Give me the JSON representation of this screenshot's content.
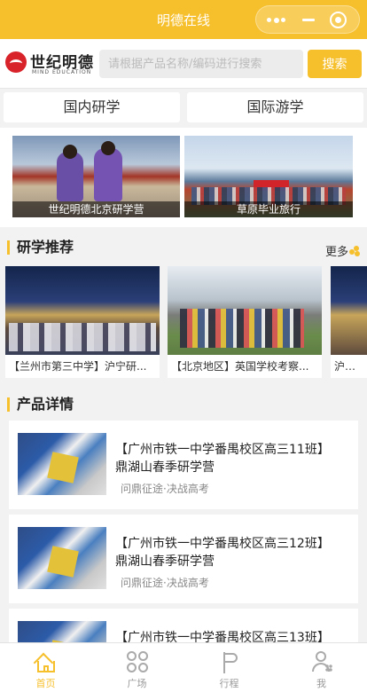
{
  "header": {
    "title": "明德在线"
  },
  "brand": {
    "name": "世纪明德",
    "sub": "MIND EDUCATION"
  },
  "search": {
    "placeholder": "请根据产品名称/编码进行搜索",
    "button": "搜索"
  },
  "categories": [
    {
      "label": "国内研学"
    },
    {
      "label": "国际游学"
    }
  ],
  "banners": [
    {
      "caption": "世纪明德北京研学营"
    },
    {
      "caption": "草原毕业旅行"
    }
  ],
  "recommend": {
    "title": "研学推荐",
    "more": "更多",
    "items": [
      {
        "label": "【兰州市第三中学】沪宁研..."
      },
      {
        "label": "【北京地区】英国学校考察..."
      },
      {
        "label": "沪宁研..."
      }
    ]
  },
  "products": {
    "title": "产品详情",
    "items": [
      {
        "line1": "【广州市铁一中学番禺校区高三11班】",
        "line2": "鼎湖山春季研学营",
        "subtitle": "问鼎征途·决战高考"
      },
      {
        "line1": "【广州市铁一中学番禺校区高三12班】",
        "line2": "鼎湖山春季研学营",
        "subtitle": "问鼎征途·决战高考"
      },
      {
        "line1": "【广州市铁一中学番禺校区高三13班】",
        "line2": "",
        "subtitle": ""
      }
    ]
  },
  "tabbar": [
    {
      "label": "首页",
      "icon": "home-icon",
      "active": true
    },
    {
      "label": "广场",
      "icon": "plaza-icon",
      "active": false
    },
    {
      "label": "行程",
      "icon": "flag-icon",
      "active": false
    },
    {
      "label": "我",
      "icon": "user-icon",
      "active": false
    }
  ],
  "colors": {
    "accent": "#f6bf2c",
    "logo_red": "#d8232a"
  }
}
